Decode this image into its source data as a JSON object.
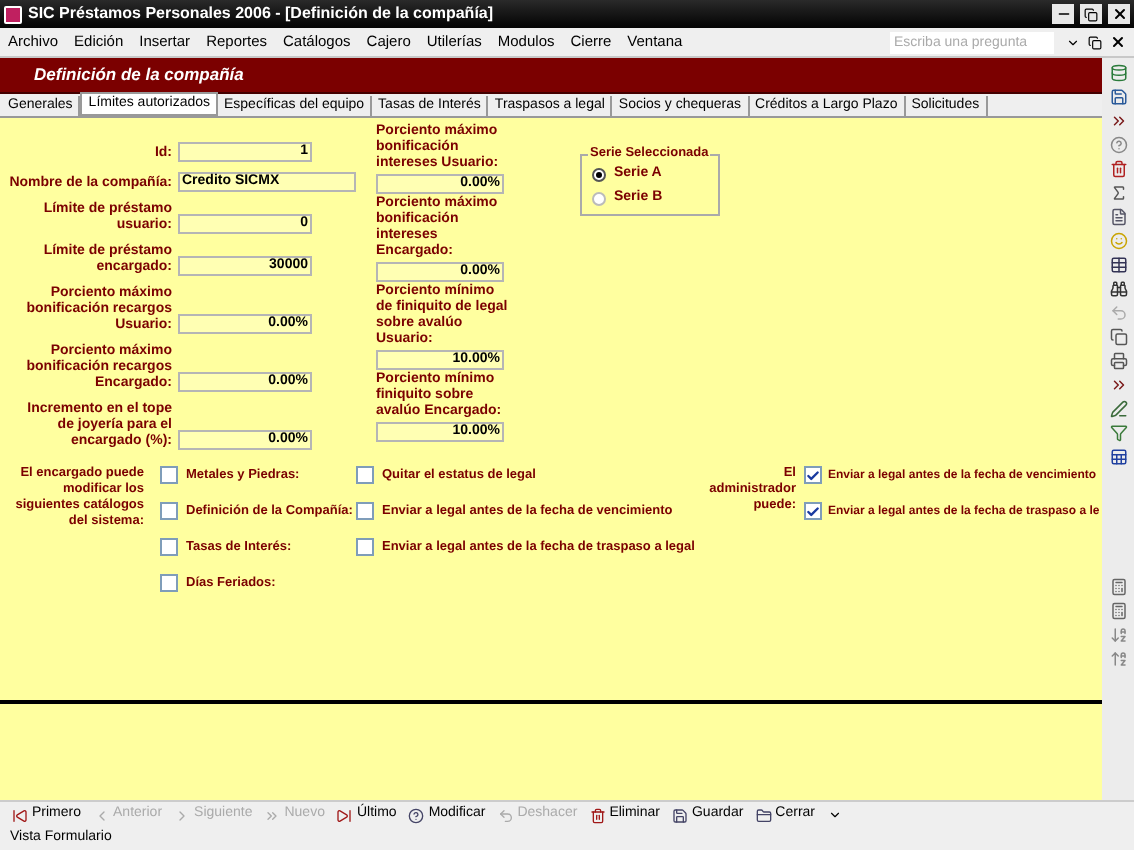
{
  "window": {
    "title": "SIC Préstamos Personales 2006 - [Definición de la compañía]"
  },
  "menu": [
    "Archivo",
    "Edición",
    "Insertar",
    "Reportes",
    "Catálogos",
    "Cajero",
    "Utilerías",
    "Modulos",
    "Cierre",
    "Ventana"
  ],
  "help_search": {
    "placeholder": "Escriba una pregunta"
  },
  "form_header": "Definición de la compañía",
  "tabs": [
    {
      "label": "Generales",
      "selected": false
    },
    {
      "label": "Límites autorizados",
      "selected": true
    },
    {
      "label": "Específicas del equipo",
      "selected": false
    },
    {
      "label": "Tasas de Interés",
      "selected": false
    },
    {
      "label": "Traspasos a legal",
      "selected": false
    },
    {
      "label": "Socios y chequeras",
      "selected": false
    },
    {
      "label": "Créditos a Largo Plazo",
      "selected": false
    },
    {
      "label": "Solicitudes",
      "selected": false
    }
  ],
  "fields_left": [
    {
      "label": "Id:",
      "value": "1",
      "kind": "number"
    },
    {
      "label": "Nombre de la compañía:",
      "value": "Credito SICMX",
      "kind": "text"
    },
    {
      "label": "Límite de préstamo usuario:",
      "value": "0",
      "kind": "number"
    },
    {
      "label": "Límite de préstamo encargado:",
      "value": "30000",
      "kind": "number"
    },
    {
      "label": "Porciento máximo bonificación recargos Usuario:",
      "value": "0.00%",
      "kind": "number"
    },
    {
      "label": "Porciento máximo bonificación recargos Encargado:",
      "value": "0.00%",
      "kind": "number"
    },
    {
      "label": "Incremento en el tope de joyería para el encargado (%):",
      "value": "0.00%",
      "kind": "number"
    }
  ],
  "fields_middle": [
    {
      "label": "Porciento máximo bonificación intereses Usuario:",
      "value": "0.00%"
    },
    {
      "label": "Porciento máximo bonificación intereses Encargado:",
      "value": "0.00%"
    },
    {
      "label": "Porciento mínimo de finiquito de legal sobre avalúo Usuario:",
      "value": "10.00%"
    },
    {
      "label": "Porciento mínimo finiquito sobre avalúo Encargado:",
      "value": "10.00%"
    }
  ],
  "series_group": {
    "title": "Serie Seleccionada",
    "options": [
      {
        "label": "Serie A",
        "selected": true
      },
      {
        "label": "Serie B",
        "selected": false
      }
    ]
  },
  "catalogs": {
    "label": "El encargado puede modificar los siguientes catálogos del sistema:",
    "items": [
      {
        "label": "Metales y Piedras:",
        "checked": false
      },
      {
        "label": "Definición de la Compañía:",
        "checked": false
      },
      {
        "label": "Tasas de Interés:",
        "checked": false
      },
      {
        "label": "Días Feriados:",
        "checked": false
      }
    ]
  },
  "legal_options": [
    {
      "label": "Quitar el estatus de legal",
      "checked": false
    },
    {
      "label": "Enviar a legal antes de la fecha de vencimiento",
      "checked": false
    },
    {
      "label": "Enviar a legal antes de la fecha de traspaso a legal",
      "checked": false
    }
  ],
  "admin": {
    "label": "El administrador puede:",
    "items": [
      {
        "label": "Enviar a legal antes de la fecha de vencimiento",
        "checked": true
      },
      {
        "label": "Enviar a legal antes de la fecha de traspaso a le",
        "checked": true
      }
    ]
  },
  "nav_toolbar": [
    {
      "label": "Primero",
      "kind": "first",
      "disabled": false
    },
    {
      "label": "Anterior",
      "kind": "previous",
      "disabled": true
    },
    {
      "label": "Siguiente",
      "kind": "next",
      "disabled": true
    },
    {
      "label": "Nuevo",
      "kind": "new",
      "disabled": true
    },
    {
      "label": "Último",
      "kind": "last",
      "disabled": false
    },
    {
      "label": "Modificar",
      "kind": "edit",
      "disabled": false
    },
    {
      "label": "Deshacer",
      "kind": "undo",
      "disabled": true
    },
    {
      "label": "Eliminar",
      "kind": "delete",
      "disabled": false
    },
    {
      "label": "Guardar",
      "kind": "save",
      "disabled": false
    },
    {
      "label": "Cerrar",
      "kind": "close",
      "disabled": false
    }
  ],
  "status_bar": "Vista Formulario"
}
